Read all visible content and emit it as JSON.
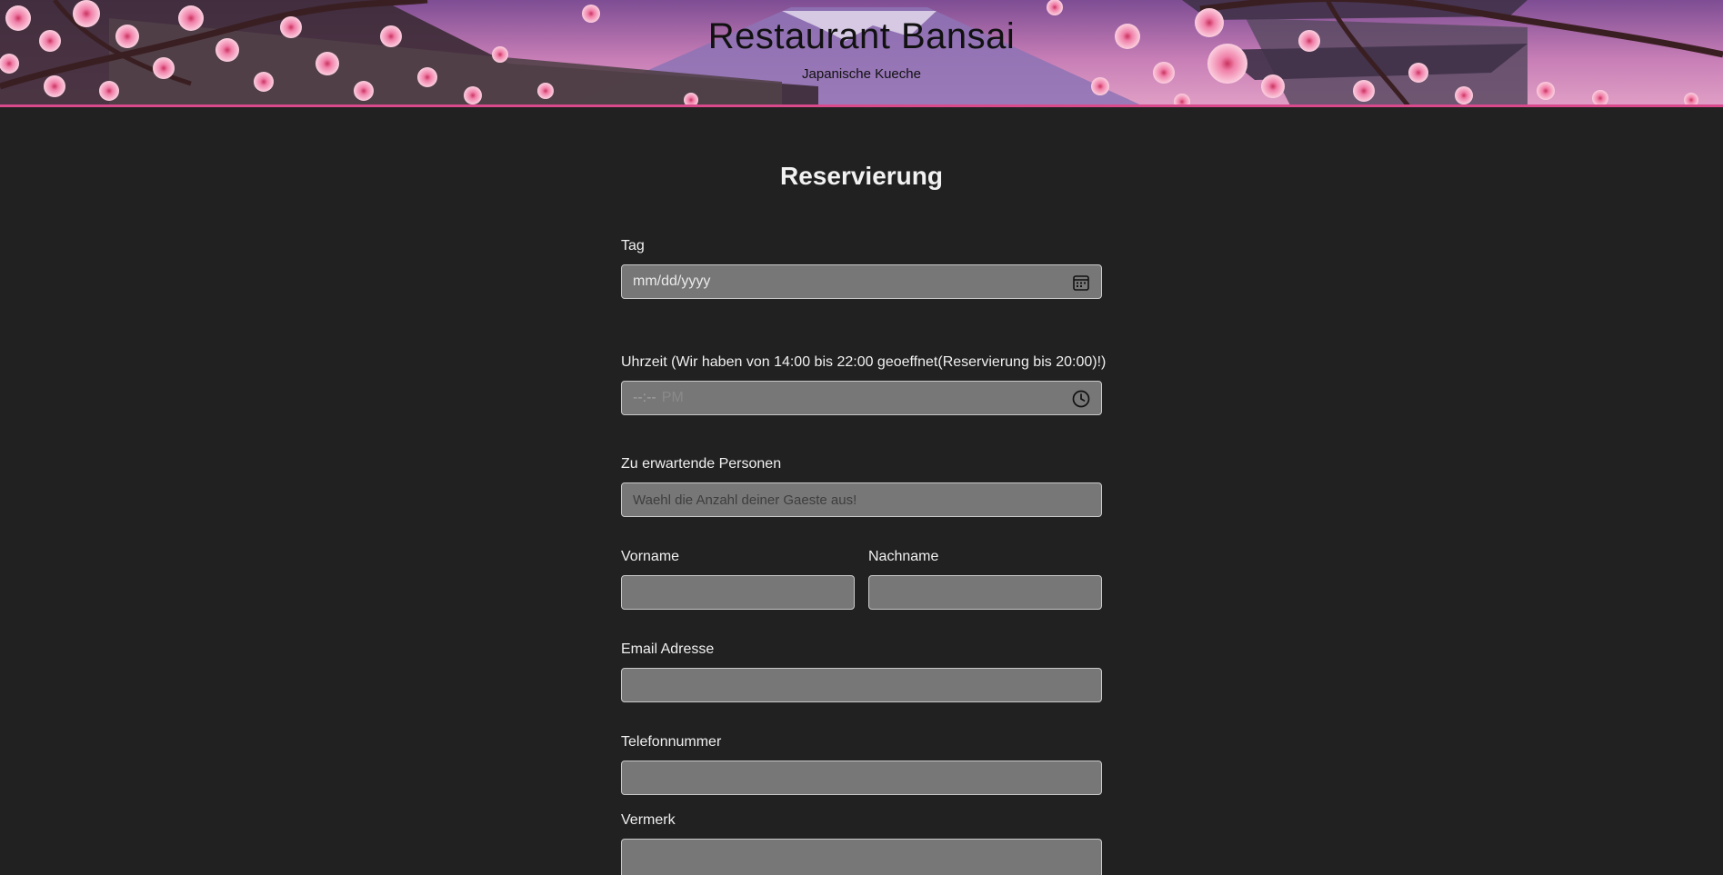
{
  "header": {
    "title": "Restaurant Bansai",
    "subtitle": "Japanische Kueche"
  },
  "form": {
    "heading": "Reservierung",
    "date": {
      "label": "Tag",
      "placeholder": "mm/dd/yyyy",
      "icon": "calendar-icon"
    },
    "time": {
      "label": "Uhrzeit (Wir haben von 14:00 bis 22:00 geoeffnet(Reservierung bis 20:00)!)",
      "placeholder": "--:--",
      "placeholder_ampm": "PM",
      "icon": "clock-icon"
    },
    "guests": {
      "label": "Zu erwartende Personen",
      "placeholder": "Waehl die Anzahl deiner Gaeste aus!"
    },
    "first_name": {
      "label": "Vorname",
      "value": ""
    },
    "last_name": {
      "label": "Nachname",
      "value": ""
    },
    "email": {
      "label": "Email Adresse",
      "value": ""
    },
    "phone": {
      "label": "Telefonnummer",
      "value": ""
    },
    "note": {
      "label": "Vermerk",
      "value": ""
    }
  },
  "colors": {
    "page_background": "#212121",
    "input_background": "#777777",
    "input_border": "#c9c9c9",
    "header_accent": "#d84a8c",
    "blossom_pink": "#f4a9c8"
  }
}
